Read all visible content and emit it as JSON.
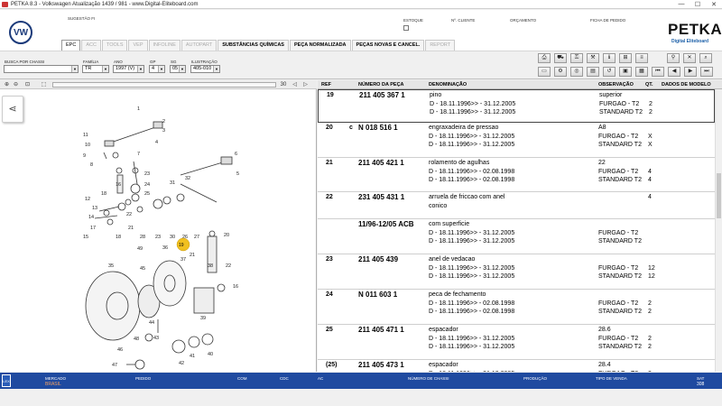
{
  "window": {
    "title": "PETKA 8.3 - Volkswagen Atualização 1439 / 981 - www.Digital-Eliteboard.com",
    "minimize": "—",
    "maximize": "☐",
    "close": "✕"
  },
  "header": {
    "brand_logo": "VW",
    "fields": {
      "sugestao": "SUGESTÃO FI",
      "estoque": "ESTOQUE",
      "cliente": "Nº. CLIENTE",
      "orcamento": "ORÇAMENTO",
      "pedido": "FICHA DE PEDIDO"
    },
    "app_name": "PETKA",
    "app_sub": "Digital Eliteboard"
  },
  "tabs": [
    {
      "label": "EPC",
      "state": "active"
    },
    {
      "label": "ACC",
      "state": "disabled"
    },
    {
      "label": "TOOLS",
      "state": "disabled"
    },
    {
      "label": "VEP",
      "state": "disabled"
    },
    {
      "label": "INFOLINE",
      "state": "disabled"
    },
    {
      "label": "AUTOPART",
      "state": "disabled"
    },
    {
      "label": "SUBSTÂNCIAS QUÍMICAS",
      "state": "enabled"
    },
    {
      "label": "PEÇA NORMALIZADA",
      "state": "enabled"
    },
    {
      "label": "PEÇAS NOVAS E CANCEL.",
      "state": "enabled"
    },
    {
      "label": "REPORT",
      "state": "disabled"
    }
  ],
  "filters": {
    "chassi_label": "BUSCA POR CHASSI",
    "chassi_value": "",
    "familia_label": "FAMÍLIA",
    "familia_value": "TR",
    "ano_label": "ANO",
    "ano_value": "1997 (V)",
    "gp_label": "GP",
    "gp_value": "4",
    "sg_label": "SG",
    "sg_value": "05",
    "ilustracao_label": "ILUSTRAÇÃO",
    "ilustracao_value": "405-010"
  },
  "zoom_value": "30",
  "table": {
    "headers": {
      "ref": "REF",
      "num": "NÚMERO DA PEÇA",
      "den": "DENOMINAÇÃO",
      "obs": "OBSERVAÇÃO",
      "qt": "QT.",
      "model": "DADOS DE MODELO"
    },
    "rows": [
      {
        "ref": "19",
        "flag": "",
        "num": "211 405 367 1",
        "lines": [
          {
            "den": "pino",
            "obs": "superior",
            "qt": "",
            "x": ""
          },
          {
            "den": "D - 18.11.1996>> - 31.12.2005",
            "obs": "FURGAO - T2",
            "qt": "2",
            "x": ""
          },
          {
            "den": "D - 18.11.1996>> - 31.12.2005",
            "obs": "STANDARD T2",
            "qt": "2",
            "x": ""
          }
        ],
        "height": 37
      },
      {
        "ref": "20",
        "flag": "c",
        "num": "N   018 516 1",
        "lines": [
          {
            "den": "engraxadeira de pressao",
            "obs": "A8",
            "qt": "",
            "x": ""
          },
          {
            "den": "D - 18.11.1996>> - 31.12.2005",
            "obs": "FURGAO - T2",
            "qt": "",
            "x": "X"
          },
          {
            "den": "D - 18.11.1996>> - 31.12.2005",
            "obs": "STANDARD T2",
            "qt": "",
            "x": "X"
          }
        ],
        "height": 39
      },
      {
        "ref": "21",
        "flag": "",
        "num": "211 405 421 1",
        "lines": [
          {
            "den": "rolamento de agulhas",
            "obs": "22",
            "qt": "",
            "x": ""
          },
          {
            "den": "D - 18.11.1996>> - 02.08.1998",
            "obs": "FURGAO - T2",
            "qt": "4",
            "x": ""
          },
          {
            "den": "D - 18.11.1996>> - 02.08.1998",
            "obs": "STANDARD T2",
            "qt": "4",
            "x": ""
          }
        ],
        "height": 38
      },
      {
        "ref": "22",
        "flag": "",
        "num": "231 405 431 1",
        "lines": [
          {
            "den": "arruela de friccao com anel",
            "obs": "",
            "qt": "4",
            "x": ""
          },
          {
            "den": "conico",
            "obs": "",
            "qt": "",
            "x": ""
          }
        ],
        "height": 30
      },
      {
        "ref": "",
        "flag": "",
        "num": "11/96-12/05 ACB",
        "lines": [
          {
            "den": "com superficie",
            "obs": "",
            "qt": "",
            "x": ""
          },
          {
            "den": "D - 18.11.1996>> - 31.12.2005",
            "obs": "FURGAO - T2",
            "qt": "",
            "x": ""
          },
          {
            "den": "D - 18.11.1996>> - 31.12.2005",
            "obs": "STANDARD T2",
            "qt": "",
            "x": ""
          }
        ],
        "height": 39
      },
      {
        "ref": "23",
        "flag": "",
        "num": "211 405 439",
        "lines": [
          {
            "den": "anel de vedacao",
            "obs": "",
            "qt": "",
            "x": ""
          },
          {
            "den": "D - 18.11.1996>> - 31.12.2005",
            "obs": "FURGAO - T2",
            "qt": "12",
            "x": ""
          },
          {
            "den": "D - 18.11.1996>> - 31.12.2005",
            "obs": "STANDARD T2",
            "qt": "12",
            "x": ""
          }
        ],
        "height": 39
      },
      {
        "ref": "24",
        "flag": "",
        "num": "N   011 603 1",
        "lines": [
          {
            "den": "peca de fechamento",
            "obs": "",
            "qt": "",
            "x": ""
          },
          {
            "den": "D - 18.11.1996>> - 02.08.1998",
            "obs": "FURGAO - T2",
            "qt": "2",
            "x": ""
          },
          {
            "den": "D - 18.11.1996>> - 02.08.1998",
            "obs": "STANDARD T2",
            "qt": "2",
            "x": ""
          }
        ],
        "height": 39
      },
      {
        "ref": "25",
        "flag": "",
        "num": "211 405 471 1",
        "lines": [
          {
            "den": "espacador",
            "obs": "28.6",
            "qt": "",
            "x": ""
          },
          {
            "den": "D - 18.11.1996>> - 31.12.2005",
            "obs": "FURGAO - T2",
            "qt": "2",
            "x": ""
          },
          {
            "den": "D - 18.11.1996>> - 31.12.2005",
            "obs": "STANDARD T2",
            "qt": "2",
            "x": ""
          }
        ],
        "height": 39
      },
      {
        "ref": "(25)",
        "flag": "",
        "num": "211 405 473 1",
        "lines": [
          {
            "den": "espacador",
            "obs": "28.4",
            "qt": "",
            "x": ""
          },
          {
            "den": "D - 18.11.1996>> - 31.12.2005",
            "obs": "FURGAO - T2",
            "qt": "2",
            "x": ""
          }
        ],
        "height": 30
      }
    ]
  },
  "status": {
    "mercado_label": "MERCADO",
    "mercado_value": "BRASIL",
    "pedido_label": "PEDIDO",
    "com_label": "COM",
    "cdc_label": "CDC",
    "ac_label": "AC",
    "chassi_label": "NÚMERO DE CHASSI",
    "producao_label": "PRODUÇÃO",
    "venda_label": "TIPO DE VENDA",
    "sat_label": "SAT",
    "sat_value": "308",
    "icon_label": "LEX"
  },
  "diagram": {
    "highlight": "19",
    "callouts": [
      "1",
      "11",
      "10",
      "9",
      "8",
      "7",
      "6",
      "5",
      "4",
      "3",
      "2",
      "12",
      "13",
      "14",
      "15",
      "16",
      "17",
      "18",
      "19",
      "20",
      "21",
      "22",
      "23",
      "24",
      "25",
      "26",
      "27",
      "28",
      "29",
      "30",
      "31",
      "32",
      "33",
      "34",
      "35",
      "36",
      "37",
      "38",
      "39",
      "40",
      "41",
      "42",
      "43",
      "44",
      "45",
      "46",
      "47",
      "48",
      "49"
    ]
  },
  "colors": {
    "status_bar": "#1f4aa0",
    "highlight": "#f0c020",
    "brand": "#1b3a7a"
  }
}
